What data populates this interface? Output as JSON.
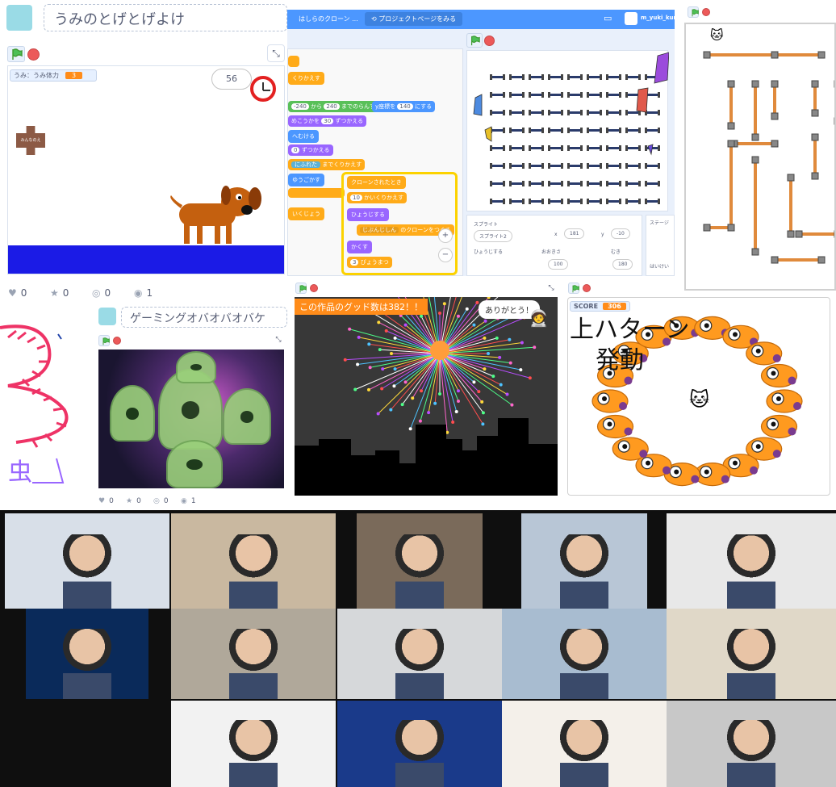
{
  "project1": {
    "title": "うみのとげとげよけ",
    "variable_label": "うみ：うみ体力",
    "variable_value": "3",
    "timer_value": "56",
    "sign_text": "みんなのえ",
    "stats": {
      "loves": "0",
      "favorites": "0",
      "remixes": "0",
      "views": "1"
    }
  },
  "editor": {
    "tab_title": "はしらのクローン ...",
    "project_page_button": "プロジェクトページをみる",
    "username": "m_yuki_kun",
    "blocks": {
      "repeat": "くりかえす",
      "random": "から",
      "random_from": "-240",
      "random_to": "240",
      "random_suffix": "までのらんすう",
      "y_label": "y座標を",
      "y_value": "140",
      "y_suffix": "にする",
      "direction": "めこうかを",
      "direction_value": "30",
      "direction_suffix": "ずつかえる",
      "point": "へむける",
      "move_value": "0",
      "move_suffix": "ずつかえる",
      "until": "にふれた",
      "until_suffix": "までくりかえす",
      "move": "ゆうごかす",
      "start": "クローンされたとき",
      "repeat_value": "10",
      "repeat2": "かいくりかえす",
      "show": "ひょうじする",
      "clone_of": "じぶんじしん",
      "clone_suffix": "のクローンをつくる",
      "hide": "かくす",
      "wait_value": "3",
      "wait_suffix": "びょうまつ",
      "forever": "いくじょう"
    },
    "sprite_panel": {
      "sprite_label": "スプライト",
      "sprite_name": "スプライト2",
      "x_label": "x",
      "x_value": "181",
      "y_label": "y",
      "y_value": "-10",
      "show_label": "ひょうじする",
      "size_label": "おおきさ",
      "size_value": "100",
      "direction_label": "むき",
      "direction_value": "180",
      "stage_label": "ステージ",
      "backdrop_label": "はいけい"
    }
  },
  "project3": {
    "title": "ゲーミングオバオバオバケ",
    "stats": {
      "loves": "0",
      "favorites": "0",
      "remixes": "0",
      "views": "1"
    }
  },
  "project4": {
    "banner": "この作品のグッド数は382！！",
    "speech": "ありがとう！"
  },
  "project5": {
    "score_label": "SCORE",
    "score_value": "306",
    "overlay_line1": "上ハターン",
    "overlay_line2": "発動"
  },
  "drawing": {
    "text": "虫"
  },
  "colors": {
    "scratch_blue": "#4c97ff",
    "motion": "#4c97ff",
    "looks": "#9966ff",
    "control": "#ffab19",
    "operators": "#59c059",
    "sensing": "#5cb1d6",
    "stop": "#ec5959",
    "video_bg": "#0f0f0f"
  },
  "icons": [
    "green-flag-icon",
    "stop-icon",
    "fullscreen-icon",
    "heart-icon",
    "star-icon",
    "remix-icon",
    "eye-icon",
    "folder-icon",
    "clock-icon",
    "zoom-in-icon",
    "zoom-out-icon"
  ],
  "video_grid": {
    "participants": 15
  }
}
